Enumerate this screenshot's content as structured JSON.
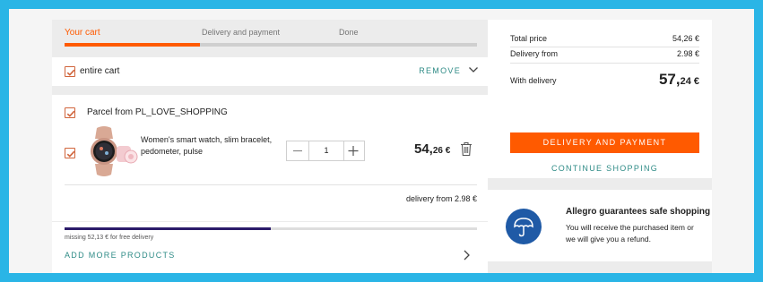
{
  "steps": [
    {
      "label": "Your cart",
      "active": true
    },
    {
      "label": "Delivery and payment",
      "active": false
    },
    {
      "label": "Done",
      "active": false
    }
  ],
  "cart_header": {
    "select_all_label": "entire cart",
    "select_all_checked": true,
    "remove_label": "REMOVE"
  },
  "parcel": {
    "title": "Parcel from PL_LOVE_SHOPPING",
    "checked": true,
    "item": {
      "checked": true,
      "description": "Women's smart watch, slim bracelet, pedometer, pulse",
      "quantity": "1",
      "price_main": "54,",
      "price_decimal": "26 €"
    },
    "delivery_from": "delivery from 2.98 €"
  },
  "free_delivery": {
    "progress_fraction": 0.5,
    "missing_text": "missing 52,13 € for free delivery",
    "add_more_label": "ADD MORE PRODUCTS"
  },
  "summary": {
    "total_price_label": "Total price",
    "total_price_value": "54,26 €",
    "delivery_from_label": "Delivery from",
    "delivery_from_value": "2.98 €",
    "with_delivery_label": "With delivery",
    "with_delivery_main": "57,",
    "with_delivery_decimal": "24 €",
    "cta_label": "DELIVERY AND PAYMENT",
    "continue_label": "CONTINUE SHOPPING"
  },
  "guarantee": {
    "title": "Allegro guarantees safe shopping",
    "line1": "You will receive the purchased item or",
    "line2": "we will give you a refund."
  },
  "colors": {
    "accent": "#ff5a00",
    "link": "#2e8b86",
    "checkbox": "#d0643b",
    "progress": "#2b1b6a",
    "frame": "#2ab5e6",
    "shield": "#1f5aa6"
  },
  "icons": [
    "checkbox-icon",
    "chevron-down-icon",
    "minus-icon",
    "plus-icon",
    "trash-icon",
    "chevron-right-icon",
    "umbrella-icon"
  ]
}
